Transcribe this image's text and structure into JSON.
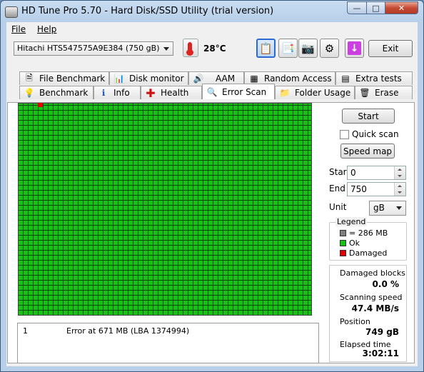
{
  "window": {
    "title": "HD Tune Pro 5.70 - Hard Disk/SSD Utility (trial version)",
    "min_glyph": "—",
    "max_glyph": "□",
    "close_glyph": "✕"
  },
  "menu": {
    "file": "File",
    "help": "Help"
  },
  "toolbar": {
    "drive": "Hitachi HTS547575A9E384 (750 gB)",
    "temperature": "28°C",
    "exit_label": "Exit",
    "download_glyph": "↓"
  },
  "tabs_top": [
    {
      "label": "File Benchmark",
      "icon": "file-benchmark-icon"
    },
    {
      "label": "Disk monitor",
      "icon": "disk-monitor-icon"
    },
    {
      "label": "AAM",
      "icon": "speaker-icon"
    },
    {
      "label": "Random Access",
      "icon": "random-access-icon"
    },
    {
      "label": "Extra tests",
      "icon": "extra-tests-icon"
    }
  ],
  "tabs_bottom": [
    {
      "label": "Benchmark",
      "icon": "benchmark-icon"
    },
    {
      "label": "Info",
      "icon": "info-icon"
    },
    {
      "label": "Health",
      "icon": "health-icon"
    },
    {
      "label": "Error Scan",
      "icon": "magnifier-icon",
      "active": true
    },
    {
      "label": "Folder Usage",
      "icon": "folder-icon"
    },
    {
      "label": "Erase",
      "icon": "trash-icon"
    }
  ],
  "scan": {
    "start_button": "Start",
    "quick_scan_label": "Quick scan",
    "speed_map_button": "Speed map",
    "start_label": "Start",
    "start_value": "0",
    "end_label": "End",
    "end_value": "750",
    "unit_label": "Unit",
    "unit_value": "gB"
  },
  "legend": {
    "title": "Legend",
    "block_size": "= 286 MB",
    "ok": "Ok",
    "damaged": "Damaged",
    "colors": {
      "block": "#808080",
      "ok": "#16c216",
      "damaged": "#e00000"
    }
  },
  "stats": {
    "damaged_label": "Damaged blocks",
    "damaged_value": "0.0 %",
    "speed_label": "Scanning speed",
    "speed_value": "47.4 MB/s",
    "position_label": "Position",
    "position_value": "749 gB",
    "elapsed_label": "Elapsed time",
    "elapsed_value": "3:02:11"
  },
  "log": [
    {
      "index": "1",
      "message": "Error at 671 MB (LBA 1374994)"
    }
  ]
}
